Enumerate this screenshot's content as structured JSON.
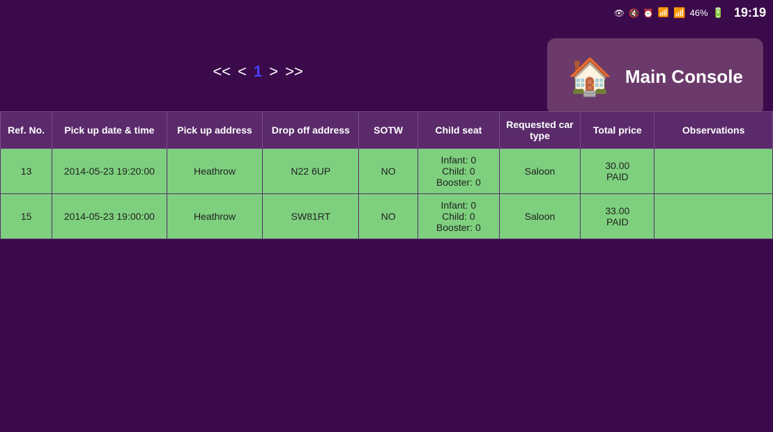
{
  "statusBar": {
    "battery": "46%",
    "time": "19:19"
  },
  "mainConsole": {
    "label": "Main Console",
    "icon": "🏠"
  },
  "pagination": {
    "first": "<<",
    "prev": "<",
    "current": "1",
    "next": ">",
    "last": ">>"
  },
  "table": {
    "headers": [
      "Ref. No.",
      "Pick up date & time",
      "Pick up address",
      "Drop off address",
      "SOTW",
      "Child seat",
      "Requested car type",
      "Total price",
      "Observations"
    ],
    "rows": [
      {
        "refNo": "13",
        "pickupDateTime": "2014-05-23 19:20:00",
        "pickupAddress": "Heathrow",
        "dropoffAddress": "N22 6UP",
        "sotw": "NO",
        "childSeat": "Infant: 0\nChild: 0\nBooster: 0",
        "carType": "Saloon",
        "totalPrice": "30.00\nPAID",
        "observations": ""
      },
      {
        "refNo": "15",
        "pickupDateTime": "2014-05-23 19:00:00",
        "pickupAddress": "Heathrow",
        "dropoffAddress": "SW81RT",
        "sotw": "NO",
        "childSeat": "Infant: 0\nChild: 0\nBooster: 0",
        "carType": "Saloon",
        "totalPrice": "33.00\nPAID",
        "observations": ""
      }
    ]
  }
}
